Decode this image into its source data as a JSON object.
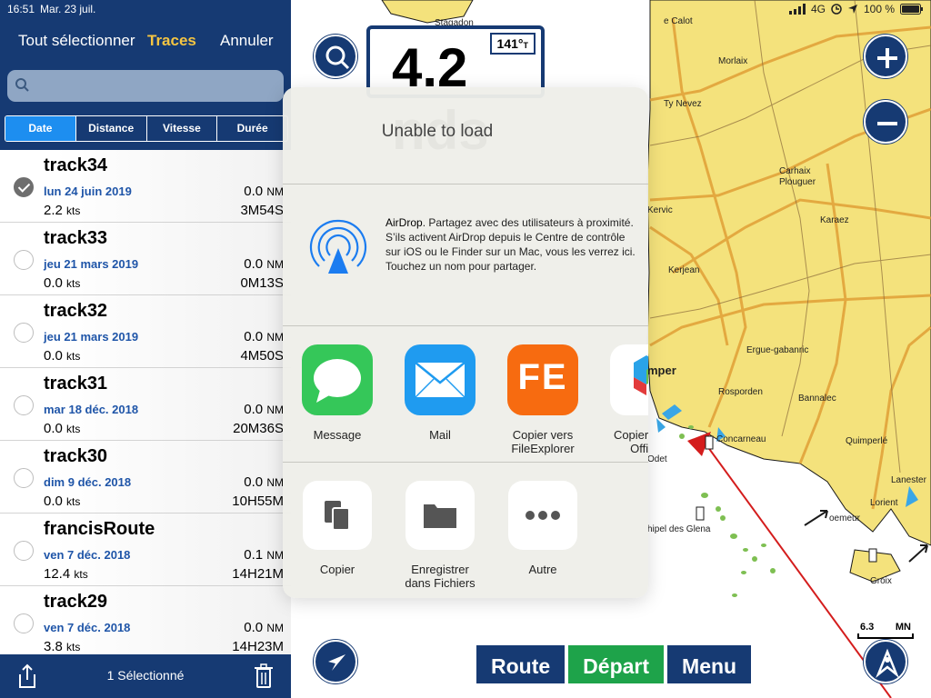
{
  "status_bar": {
    "time": "16:51",
    "date": "Mar. 23 juil.",
    "network": "4G",
    "battery": "100 %"
  },
  "sidebar": {
    "select_all": "Tout sélectionner",
    "title": "Traces",
    "cancel": "Annuler",
    "search_placeholder": "",
    "segments": [
      "Date",
      "Distance",
      "Vitesse",
      "Durée"
    ],
    "active_segment": "Date",
    "tracks": [
      {
        "name": "track34",
        "date": "lun 24 juin 2019",
        "distance": "0.0",
        "speed": "2.2",
        "duration": "3M54S",
        "selected": true
      },
      {
        "name": "track33",
        "date": "jeu 21 mars 2019",
        "distance": "0.0",
        "speed": "0.0",
        "duration": "0M13S",
        "selected": false
      },
      {
        "name": "track32",
        "date": "jeu 21 mars 2019",
        "distance": "0.0",
        "speed": "0.0",
        "duration": "4M50S",
        "selected": false
      },
      {
        "name": "track31",
        "date": "mar 18 déc. 2018",
        "distance": "0.0",
        "speed": "0.0",
        "duration": "20M36S",
        "selected": false
      },
      {
        "name": "track30",
        "date": "dim 9 déc. 2018",
        "distance": "0.0",
        "speed": "0.0",
        "duration": "10H55M",
        "selected": false
      },
      {
        "name": "francisRoute",
        "date": "ven 7 déc. 2018",
        "distance": "0.1",
        "speed": "12.4",
        "duration": "14H21M",
        "selected": false
      },
      {
        "name": "track29",
        "date": "ven 7 déc. 2018",
        "distance": "0.0",
        "speed": "3.8",
        "duration": "14H23M",
        "selected": false
      }
    ],
    "distance_unit": "NM",
    "speed_unit": "kts",
    "footer_count": "1 Sélectionné"
  },
  "map": {
    "heading": "141°",
    "heading_ref": "T",
    "speed_display": "4.2 nds",
    "places": [
      {
        "id": "stagadon",
        "text": "Stagadon"
      },
      {
        "id": "calot",
        "text": "e Calot"
      },
      {
        "id": "morlaix",
        "text": "Morlaix"
      },
      {
        "id": "tynevez",
        "text": "Ty Nevez"
      },
      {
        "id": "carhaix",
        "text": "Carhaix\nPlouguer"
      },
      {
        "id": "kervic",
        "text": "Kervic"
      },
      {
        "id": "karaez",
        "text": "Karaez"
      },
      {
        "id": "kerjean",
        "text": "Kerjean"
      },
      {
        "id": "ergue",
        "text": "Ergue-gabanric"
      },
      {
        "id": "mper",
        "text": "mper"
      },
      {
        "id": "rosporden",
        "text": "Rosporden"
      },
      {
        "id": "bannalec",
        "text": "Bannalec"
      },
      {
        "id": "concarneau",
        "text": "Concarneau"
      },
      {
        "id": "quimperle",
        "text": "Quimperlé"
      },
      {
        "id": "lanester",
        "text": "Lanester"
      },
      {
        "id": "lorient",
        "text": "Lorient"
      },
      {
        "id": "glenan",
        "text": "hipel des Glena"
      },
      {
        "id": "loemeur",
        "text": "oemeur"
      },
      {
        "id": "groix",
        "text": "Groix"
      },
      {
        "id": "odet",
        "text": "Odet"
      }
    ],
    "scale_value": "6.3",
    "scale_unit": "MN",
    "buttons": {
      "route": "Route",
      "depart": "Départ",
      "menu": "Menu"
    }
  },
  "share_sheet": {
    "title": "Unable to load",
    "airdrop_title": "AirDrop",
    "airdrop_text": ". Partagez avec des utilisateurs à proximité. S’ils activent AirDrop depuis le Centre de contrôle sur iOS ou le Finder sur un Mac, vous les verrez ici. Touchez un nom pour partager.",
    "apps": [
      {
        "label": "Message"
      },
      {
        "label": "Mail"
      },
      {
        "label": "Copier vers\nFileExplorer"
      },
      {
        "label": "Copier dans\nOffice"
      }
    ],
    "fe_letters": "FE",
    "actions": [
      {
        "label": "Copier"
      },
      {
        "label": "Enregistrer\ndans Fichiers"
      },
      {
        "label": "Autre"
      }
    ]
  },
  "colors": {
    "navy": "#163a73",
    "accent_yellow": "#f5c542",
    "segment_active": "#1d8ef0",
    "date_blue": "#1f55a8",
    "land": "#f4e27c",
    "water": "#ffffff",
    "green_button": "#1ea34a",
    "road": "#e2a33a"
  }
}
